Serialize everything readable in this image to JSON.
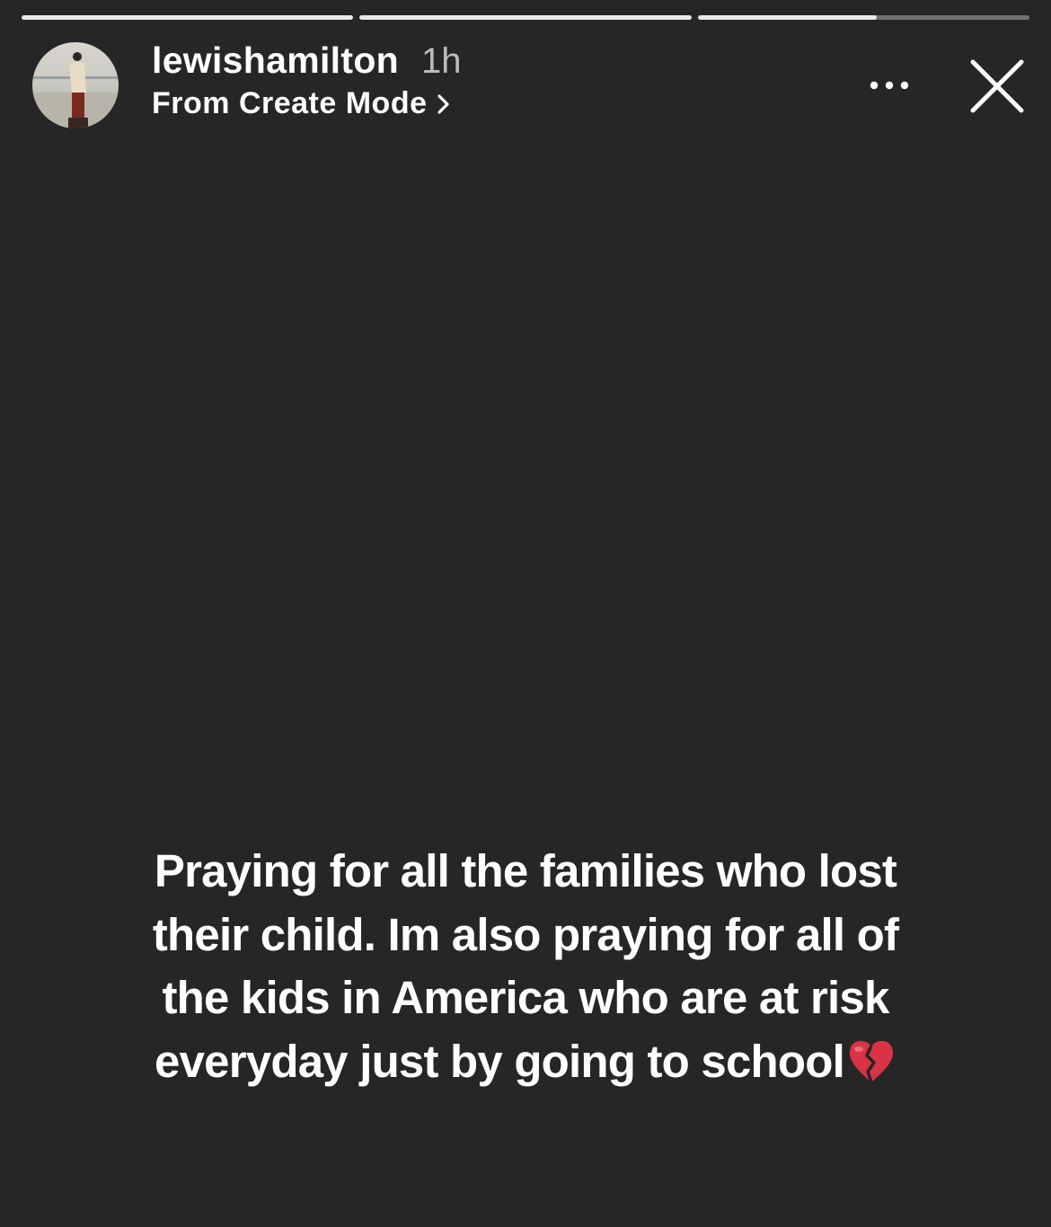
{
  "progress": {
    "segments": [
      {
        "fill": 1.0
      },
      {
        "fill": 1.0
      },
      {
        "fill": 0.54
      }
    ]
  },
  "header": {
    "username": "lewishamilton",
    "time": "1h",
    "subtitle": "From Create Mode",
    "avatar_icon": "profile-photo",
    "more_icon": "more-horizontal-icon",
    "close_icon": "close-icon"
  },
  "story": {
    "lines": [
      "Praying for all the families who lost",
      "their child. Im also praying for all of",
      "the kids in America who are at risk",
      "everyday just by going to school"
    ],
    "emoji": "broken-heart-icon"
  },
  "colors": {
    "background": "#262626",
    "text": "#ffffff",
    "time": "#bdbdbd",
    "heart": "#d93445"
  }
}
